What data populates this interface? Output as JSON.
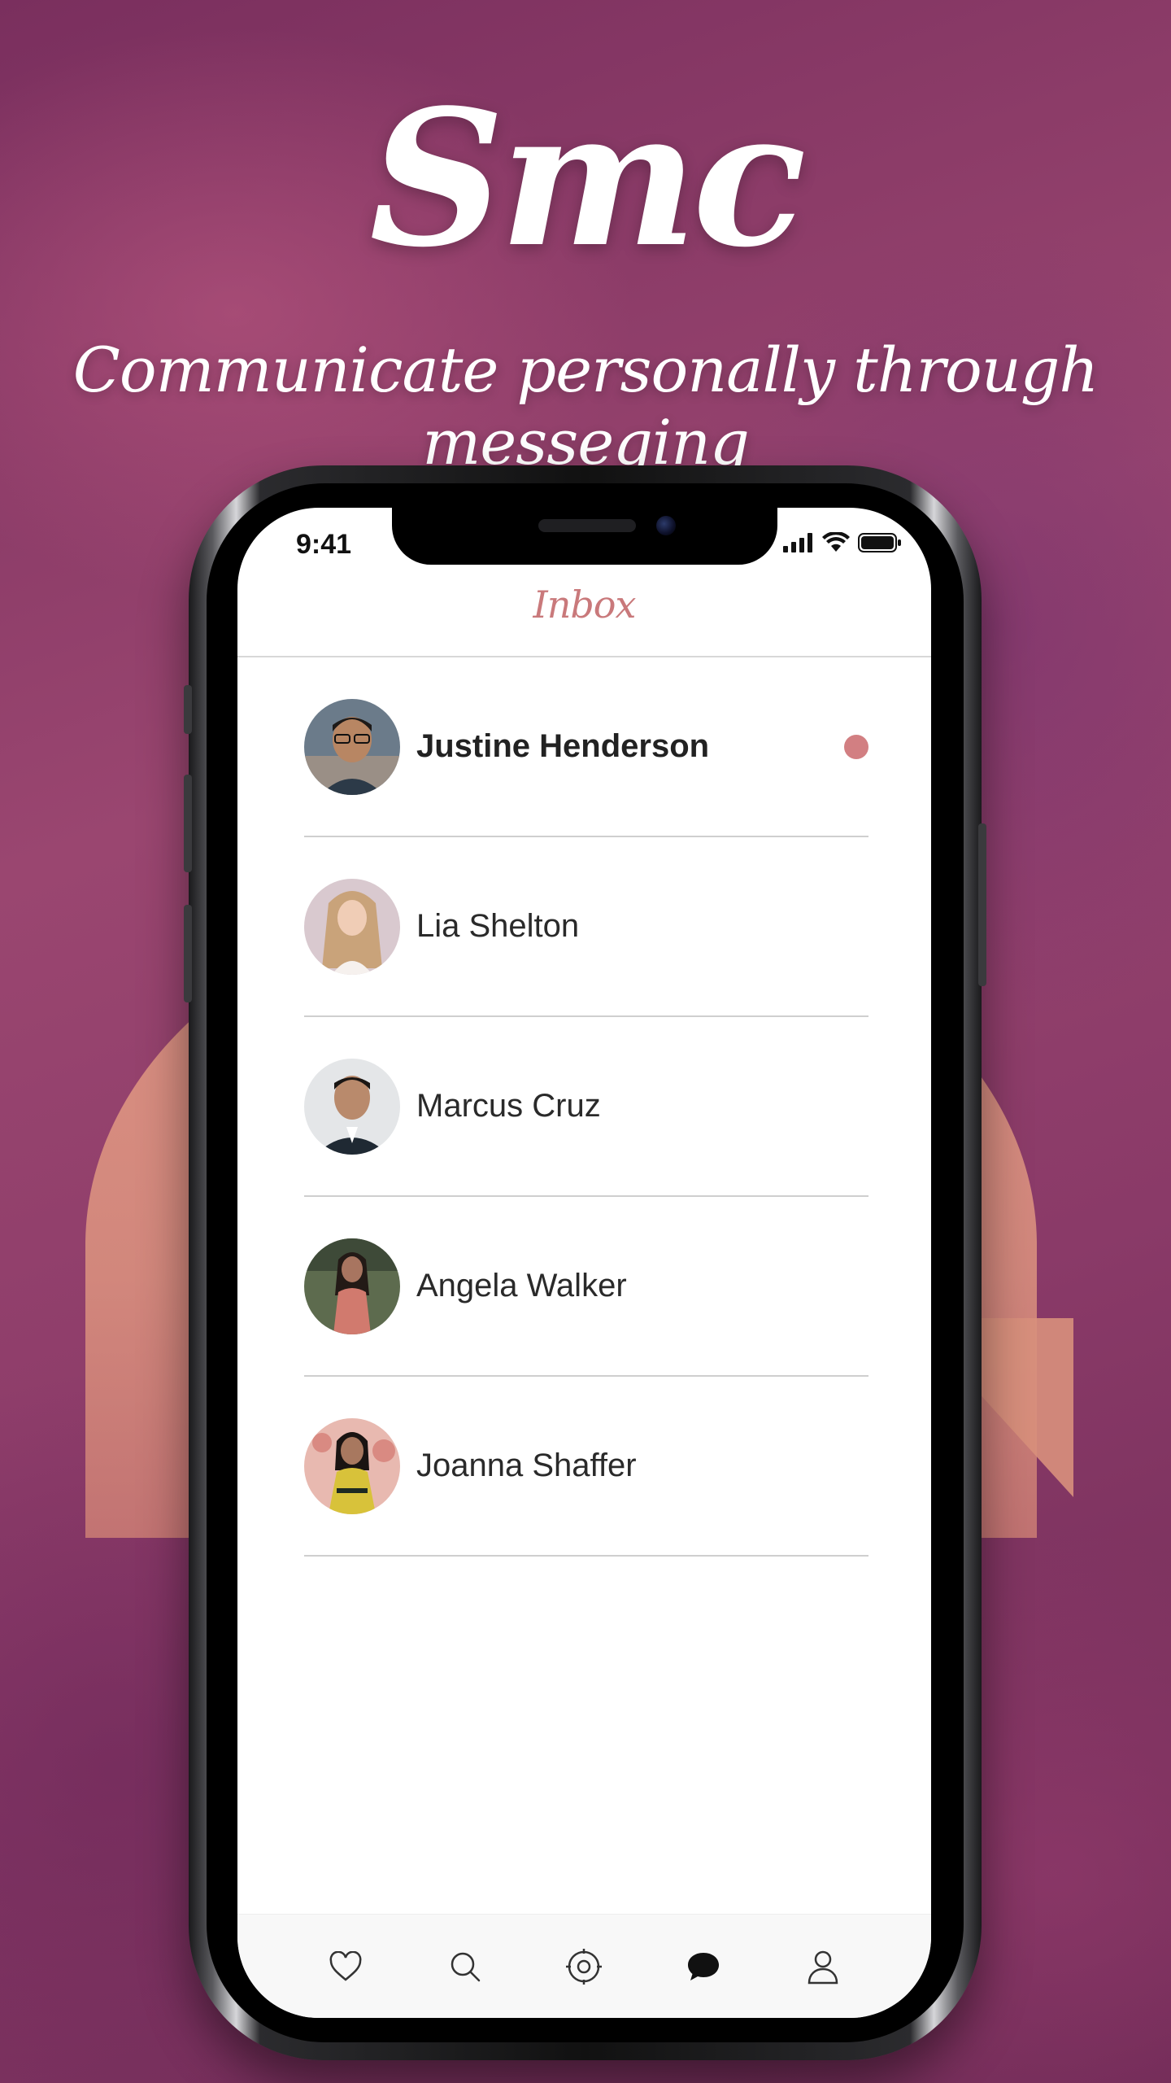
{
  "branding": {
    "logo": "Smc",
    "tagline": "Communicate personally through messeging"
  },
  "status_bar": {
    "time": "9:41"
  },
  "inbox": {
    "title": "Inbox",
    "contacts": [
      {
        "name": "Justine Henderson",
        "unread": true
      },
      {
        "name": "Lia Shelton",
        "unread": false
      },
      {
        "name": "Marcus Cruz",
        "unread": false
      },
      {
        "name": "Angela Walker",
        "unread": false
      },
      {
        "name": "Joanna Shaffer",
        "unread": false
      }
    ]
  },
  "tab_bar": {
    "items": [
      {
        "icon": "heart-icon",
        "active": false
      },
      {
        "icon": "search-icon",
        "active": false
      },
      {
        "icon": "target-icon",
        "active": false
      },
      {
        "icon": "chat-bubble-icon",
        "active": true
      },
      {
        "icon": "user-icon",
        "active": false
      }
    ]
  },
  "colors": {
    "accent": "#c9797b",
    "unread_dot": "#d27f82",
    "background": "#8a3a68"
  }
}
